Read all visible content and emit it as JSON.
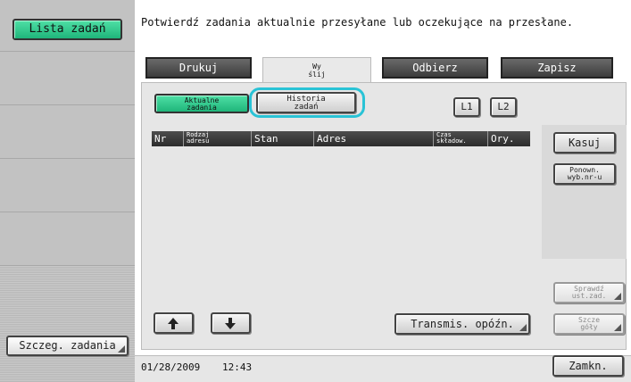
{
  "sidebar": {
    "job_list_button": "Lista zadań",
    "job_details_button": "Szczeg. zadania"
  },
  "message": "Potwierdź zadania aktualnie przesyłane lub oczekujące na przesłane.",
  "tabs": {
    "print": "Drukuj",
    "send_line1": "Wy",
    "send_line2": "ślij",
    "receive": "Odbierz",
    "save": "Zapisz"
  },
  "subtabs": {
    "current_line1": "Aktualne",
    "current_line2": "zadania",
    "history_line1": "Historia",
    "history_line2": "zadań"
  },
  "line_buttons": {
    "l1": "L1",
    "l2": "L2"
  },
  "table": {
    "headers": {
      "nr": "Nr",
      "address_type_line1": "Rodzaj",
      "address_type_line2": "adresu",
      "status": "Stan",
      "address": "Adres",
      "time_line1": "Czas",
      "time_line2": "składow.",
      "orig": "Ory."
    },
    "rows": []
  },
  "right_buttons": {
    "delete": "Kasuj",
    "redial_line1": "Ponown.",
    "redial_line2": "wyb.nr-u",
    "check_line1": "Sprawdź",
    "check_line2": "ust.zad.",
    "details_line1": "Szcze",
    "details_line2": "góły"
  },
  "nav": {
    "up_icon": "arrow-up-icon",
    "down_icon": "arrow-down-icon",
    "delayed_tx": "Transmis. opóźn."
  },
  "footer": {
    "date": "01/28/2009",
    "time": "12:43",
    "close": "Zamkn."
  },
  "colors": {
    "accent_green": "#2ecf8e",
    "highlight_ring": "#29c3d6"
  }
}
